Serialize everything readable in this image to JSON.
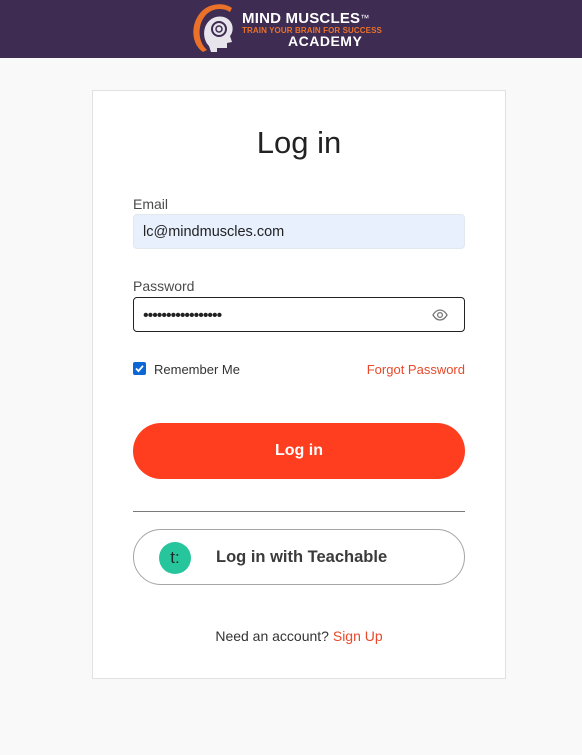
{
  "brand": {
    "name_line1": "MIND MUSCLES",
    "trademark": "™",
    "tagline": "TRAIN YOUR BRAIN FOR SUCCESS",
    "name_line2": "ACADEMY",
    "primary_color": "#3e2c52",
    "accent_color": "#e9712a"
  },
  "login": {
    "title": "Log in",
    "email_label": "Email",
    "email_value": "lc@mindmuscles.com",
    "password_label": "Password",
    "password_value": "•••••••••••••••••",
    "password_toggle_icon": "eye-icon",
    "remember_label": "Remember Me",
    "remember_checked": true,
    "forgot_label": "Forgot Password",
    "submit_label": "Log in",
    "submit_color": "#ff3d1f",
    "teachable_icon_text": "t:",
    "teachable_label": "Log in with Teachable",
    "need_account_text": "Need an account?",
    "signup_label": "Sign Up"
  }
}
